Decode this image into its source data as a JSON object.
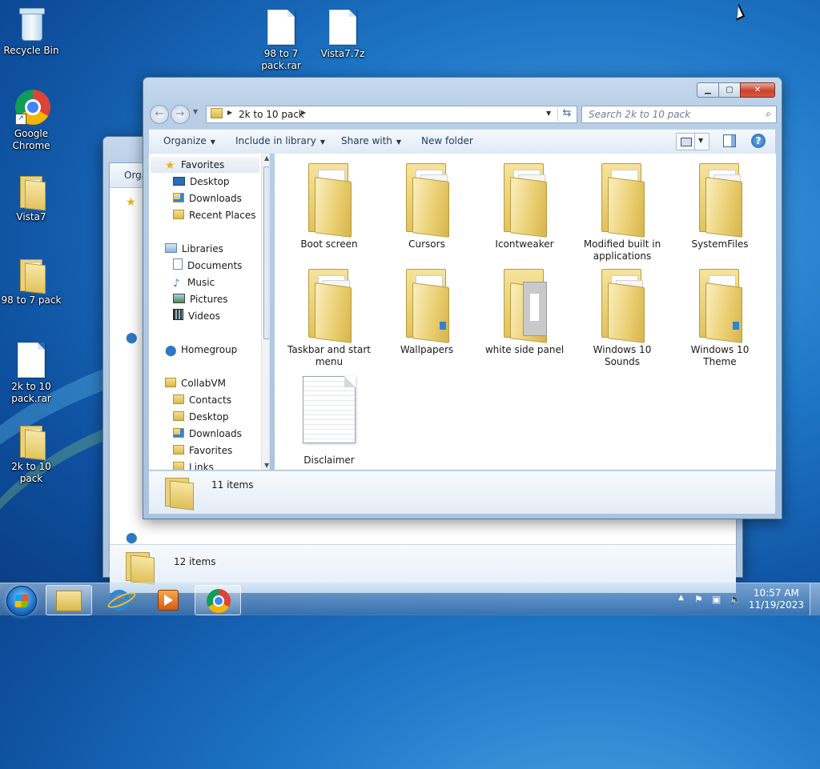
{
  "desktop": {
    "icons": [
      {
        "label": "Recycle Bin"
      },
      {
        "label": "Google Chrome"
      },
      {
        "label": "Vista7"
      },
      {
        "label": "98 to 7 pack"
      },
      {
        "label": "2k to 10 pack.rar"
      },
      {
        "label": "2k to 10 pack"
      },
      {
        "label": "98 to 7 pack.rar"
      },
      {
        "label": "Vista7.7z"
      }
    ]
  },
  "back_window": {
    "toolbar_partial": "Orga",
    "status": "12 items"
  },
  "window": {
    "breadcrumb": [
      "2k to 10 pack"
    ],
    "search_placeholder": "Search 2k to 10 pack",
    "toolbar": {
      "organize": "Organize",
      "include": "Include in library",
      "share": "Share with",
      "new_folder": "New folder"
    },
    "nav": {
      "favorites": "Favorites",
      "desktop": "Desktop",
      "downloads": "Downloads",
      "recent": "Recent Places",
      "libraries": "Libraries",
      "documents": "Documents",
      "music": "Music",
      "pictures": "Pictures",
      "videos": "Videos",
      "homegroup": "Homegroup",
      "user": "CollabVM",
      "contacts": "Contacts",
      "user_desktop": "Desktop",
      "user_downloads": "Downloads",
      "user_favorites": "Favorites",
      "links": "Links"
    },
    "items": [
      {
        "name": "Boot screen",
        "type": "folder"
      },
      {
        "name": "Cursors",
        "type": "folder"
      },
      {
        "name": "Icontweaker",
        "type": "folder"
      },
      {
        "name": "Modified built in applications",
        "type": "folder"
      },
      {
        "name": "SystemFiles",
        "type": "folder"
      },
      {
        "name": "Taskbar and start menu",
        "type": "folder"
      },
      {
        "name": "Wallpapers",
        "type": "folder"
      },
      {
        "name": "white side panel",
        "type": "folder"
      },
      {
        "name": "Windows 10 Sounds",
        "type": "folder"
      },
      {
        "name": "Windows 10 Theme",
        "type": "folder"
      },
      {
        "name": "Disclaimer",
        "type": "text-file"
      }
    ],
    "status": "11 items"
  },
  "taskbar": {
    "buttons": [
      "explorer-icon",
      "internet-explorer-icon",
      "media-player-icon",
      "chrome-icon"
    ],
    "time": "10:57 AM",
    "date": "11/19/2023"
  }
}
